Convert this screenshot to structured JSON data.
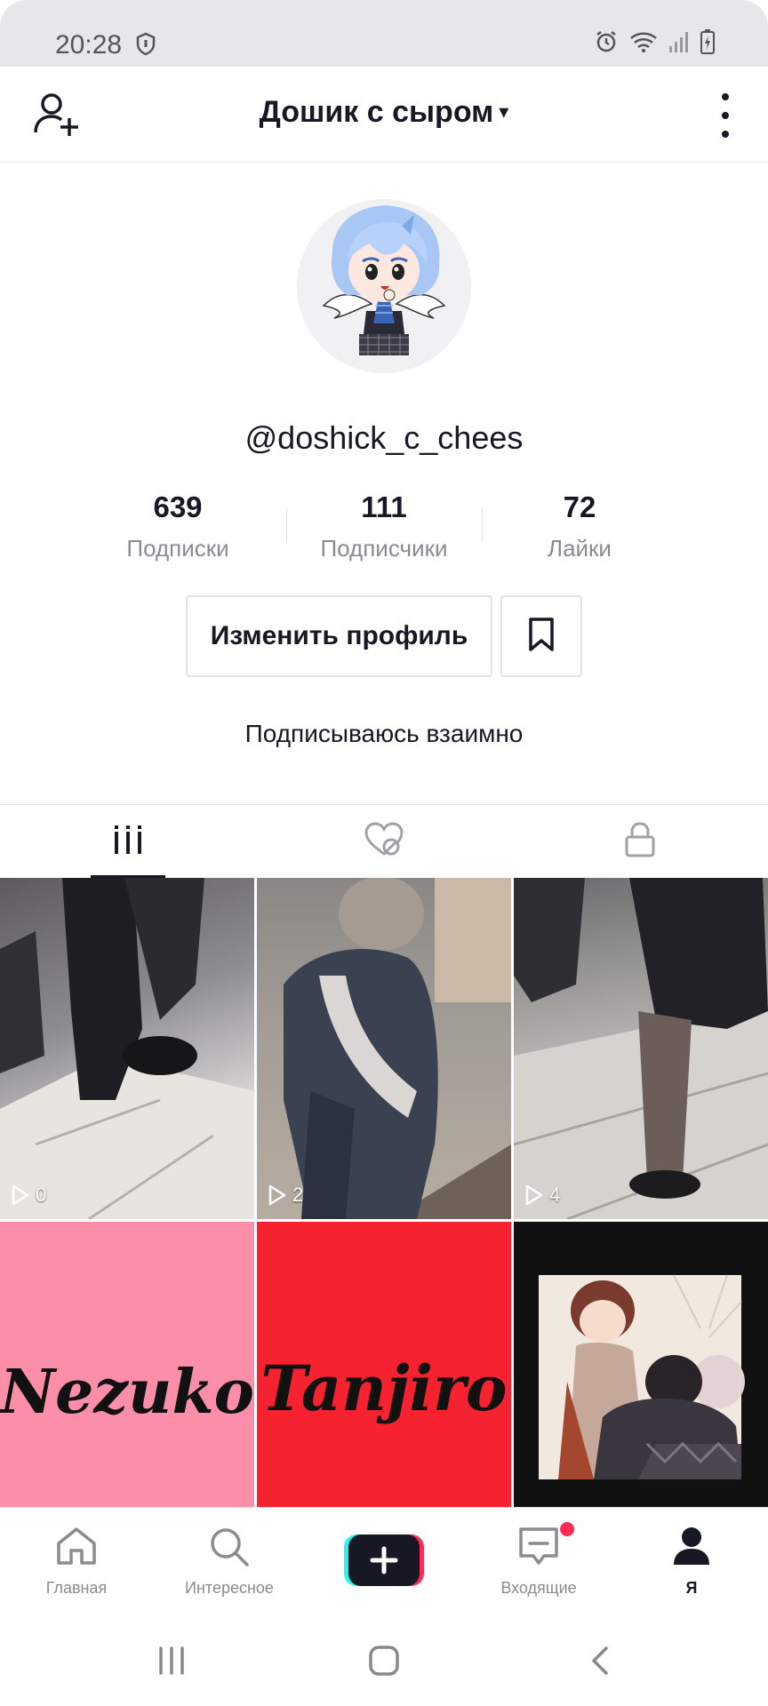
{
  "status_bar": {
    "time": "20:28"
  },
  "header": {
    "title": "Дошик с сыром",
    "caret": "▾"
  },
  "profile": {
    "username": "@doshick_c_chees",
    "stats": [
      {
        "value": "639",
        "label": "Подписки"
      },
      {
        "value": "111",
        "label": "Подписчики"
      },
      {
        "value": "72",
        "label": "Лайки"
      }
    ],
    "edit_label": "Изменить профиль",
    "bio": "Подписываюсь взаимно"
  },
  "videos": [
    {
      "views": "0"
    },
    {
      "views": "2"
    },
    {
      "views": "4"
    },
    {
      "text": "Nezuko"
    },
    {
      "text": "Tanjiro"
    },
    {
      "text": ""
    }
  ],
  "bottom_nav": {
    "home": "Главная",
    "discover": "Интересное",
    "inbox": "Входящие",
    "me": "Я"
  },
  "colors": {
    "accent_red": "#fe2c55",
    "accent_cyan": "#25f4ee",
    "text": "#161823",
    "secondary": "#8a8b91"
  },
  "icons": {
    "header_left": "add-user-icon",
    "header_right": "more-vertical-icon",
    "tab1": "grid-icon",
    "tab2": "liked-hidden-icon",
    "tab3": "lock-icon"
  }
}
